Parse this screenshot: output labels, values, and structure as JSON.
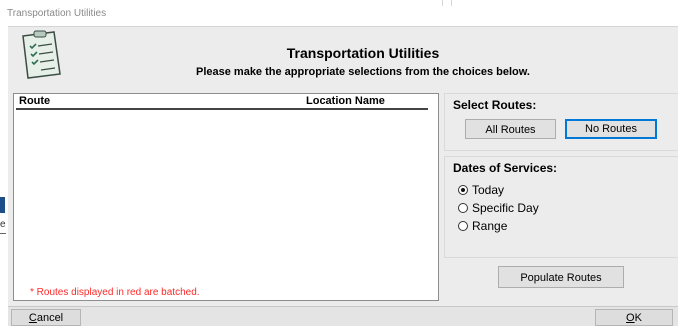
{
  "window": {
    "title": "Transportation Utilities"
  },
  "header": {
    "title": "Transportation Utilities",
    "subtitle": "Please make the appropriate selections from the choices below.",
    "logo_icon": "clipboard-checklist-icon"
  },
  "route_list": {
    "columns": [
      "Route",
      "Location Name"
    ],
    "rows": [],
    "note": "* Routes displayed in red are batched.",
    "note_color": "#ff2a2a"
  },
  "select_routes": {
    "legend": "Select Routes:",
    "all_label": "All Routes",
    "none_label": "No Routes"
  },
  "dates_of_service": {
    "legend": "Dates of Services:",
    "options": [
      "Today",
      "Specific Day",
      "Range"
    ],
    "selected": "Today"
  },
  "buttons": {
    "populate": "Populate Routes",
    "cancel_first": "C",
    "cancel_rest": "ancel",
    "ok_first": "O",
    "ok_rest": "K"
  },
  "background": {
    "edge_text": "e"
  },
  "colors": {
    "accent_border": "#0078d7",
    "panel_bg": "#ececec"
  }
}
